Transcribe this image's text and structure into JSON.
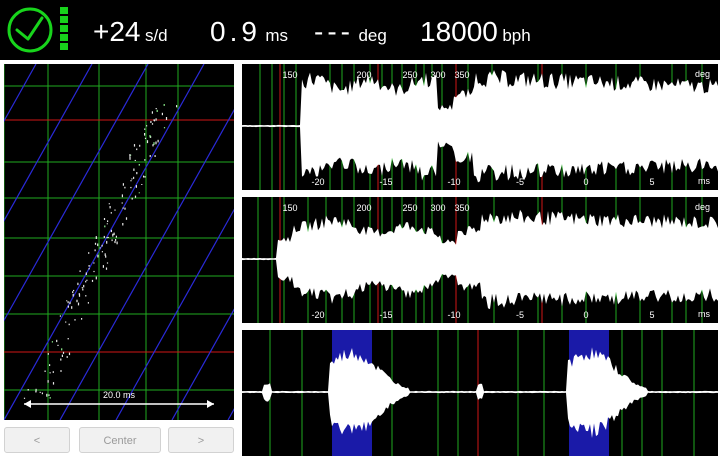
{
  "header": {
    "clock_icon": "clock-icon",
    "signal_icon": "signal-bars-icon",
    "signal_level": 1.0,
    "rate": {
      "value": "+24",
      "unit": "s/d"
    },
    "beat_error": {
      "value": "0.9",
      "unit": "ms"
    },
    "amplitude": {
      "value": "---",
      "unit": "deg"
    },
    "bph": {
      "value": "18000",
      "unit": "bph"
    }
  },
  "paper": {
    "scale_label": "20.0 ms",
    "buttons": {
      "prev": "<",
      "center": "Center",
      "next": ">"
    }
  },
  "scopes": {
    "deg_ticks": [
      "150",
      "200",
      "250",
      "300",
      "350"
    ],
    "deg_unit": "deg",
    "ms_ticks": [
      "-20",
      "-15",
      "-10",
      "-5",
      "0",
      "5"
    ],
    "ms_unit": "ms"
  },
  "colors": {
    "accent": "#18d41c",
    "grid_green": "#1faa1f",
    "grid_red": "#d01616",
    "trace_blue": "#2a2ad8",
    "highlight_blue": "#1a1aa8",
    "background": "#000000"
  }
}
